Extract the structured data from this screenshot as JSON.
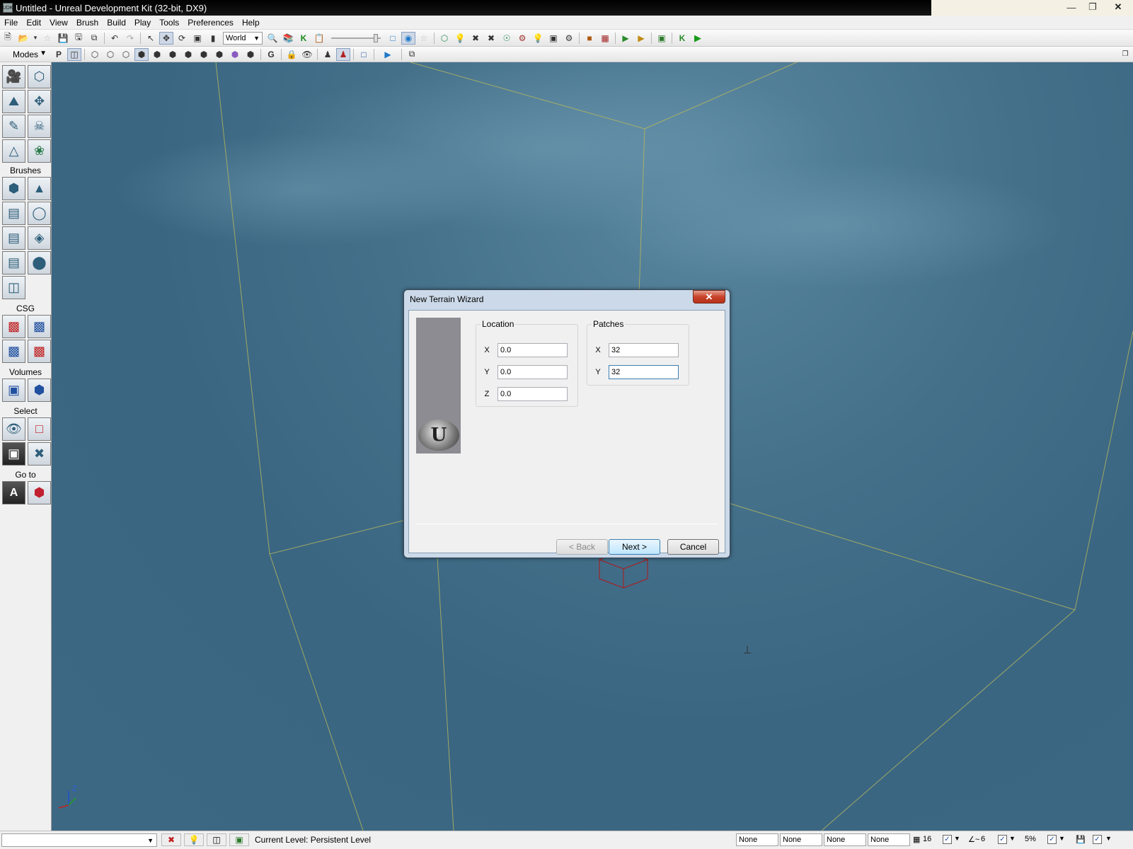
{
  "window": {
    "title": "Untitled - Unreal Development Kit (32-bit, DX9)",
    "app_icon_text": "UDK"
  },
  "menubar": {
    "items": [
      "File",
      "Edit",
      "View",
      "Brush",
      "Build",
      "Play",
      "Tools",
      "Preferences",
      "Help"
    ]
  },
  "toolbar": {
    "coordinate_system": "World"
  },
  "left_panel": {
    "modes_label": "Modes",
    "brushes_label": "Brushes",
    "csg_label": "CSG",
    "volumes_label": "Volumes",
    "select_label": "Select",
    "goto_label": "Go to",
    "goto_actor_icon_text": "A"
  },
  "viewport": {
    "axis_z": "Z"
  },
  "dialog": {
    "title": "New Terrain Wizard",
    "location": {
      "legend": "Location",
      "x_label": "X",
      "x_value": "0.0",
      "y_label": "Y",
      "y_value": "0.0",
      "z_label": "Z",
      "z_value": "0.0"
    },
    "patches": {
      "legend": "Patches",
      "x_label": "X",
      "x_value": "32",
      "y_label": "Y",
      "y_value": "32"
    },
    "back_label": "< Back",
    "next_label": "Next >",
    "cancel_label": "Cancel"
  },
  "statusbar": {
    "current_level_label": "Current Level:",
    "current_level_value": "Persistent Level",
    "fields": [
      "None",
      "None",
      "None",
      "None"
    ],
    "grid_size": "16",
    "rotation_snap": "6",
    "scale_snap": "5%"
  }
}
